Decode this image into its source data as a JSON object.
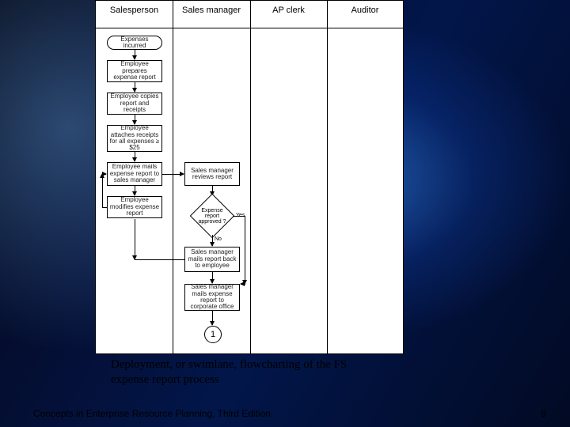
{
  "chart_data": {
    "type": "swimlane-flowchart",
    "title": "Deployment, or swimlane, flowcharting of the FS expense report process",
    "lanes": [
      "Salesperson",
      "Sales manager",
      "AP clerk",
      "Auditor"
    ],
    "nodes": [
      {
        "id": "n1",
        "lane": 0,
        "type": "terminator",
        "label": "Expenses incurred"
      },
      {
        "id": "n2",
        "lane": 0,
        "type": "process",
        "label": "Employee prepares expense report"
      },
      {
        "id": "n3",
        "lane": 0,
        "type": "process",
        "label": "Employee copies report and receipts"
      },
      {
        "id": "n4",
        "lane": 0,
        "type": "process",
        "label": "Employee attaches receipts for all expenses ≥ $25"
      },
      {
        "id": "n5",
        "lane": 0,
        "type": "process",
        "label": "Employee mails expense report to sales manager"
      },
      {
        "id": "n6",
        "lane": 0,
        "type": "process",
        "label": "Employee modifies expense report"
      },
      {
        "id": "n7",
        "lane": 1,
        "type": "process",
        "label": "Sales manager reviews report"
      },
      {
        "id": "d1",
        "lane": 1,
        "type": "decision",
        "label": "Expense report approved?"
      },
      {
        "id": "n8",
        "lane": 1,
        "type": "process",
        "label": "Sales manager mails report back to employee"
      },
      {
        "id": "n9",
        "lane": 1,
        "type": "process",
        "label": "Sales manager mails expense report to corporate office"
      },
      {
        "id": "c1",
        "lane": 1,
        "type": "connector",
        "label": "1"
      }
    ],
    "edges": [
      {
        "from": "n1",
        "to": "n2"
      },
      {
        "from": "n2",
        "to": "n3"
      },
      {
        "from": "n3",
        "to": "n4"
      },
      {
        "from": "n4",
        "to": "n5"
      },
      {
        "from": "n5",
        "to": "n7"
      },
      {
        "from": "n7",
        "to": "d1"
      },
      {
        "from": "d1",
        "to": "n8",
        "label": "No"
      },
      {
        "from": "d1",
        "to": "n9",
        "label": "Yes",
        "via": "right-down"
      },
      {
        "from": "n8",
        "to": "n6"
      },
      {
        "from": "n6",
        "to": "n5",
        "dir": "up"
      },
      {
        "from": "n9",
        "to": "c1"
      }
    ]
  },
  "lanes": {
    "l0": "Salesperson",
    "l1": "Sales manager",
    "l2": "AP clerk",
    "l3": "Auditor"
  },
  "nodes": {
    "n1": "Expenses incurred",
    "n2": "Employee prepares expense report",
    "n3": "Employee copies report and receipts",
    "n4": "Employee attaches receipts for all expenses ≥ $25",
    "n5": "Employee mails expense report to sales manager",
    "n6": "Employee modifies expense report",
    "n7": "Sales manager reviews report",
    "d1": "Expense report approved ?",
    "n8": "Sales manager mails report back to employee",
    "n9": "Sales manager mails expense report to corporate office",
    "c1": "1",
    "yes": "Yes",
    "no": "No"
  },
  "caption": "Deployment, or swimlane, flowcharting of the FS expense report process",
  "footer": "Concepts in Enterprise Resource Planning, Third Edition",
  "page": "9"
}
